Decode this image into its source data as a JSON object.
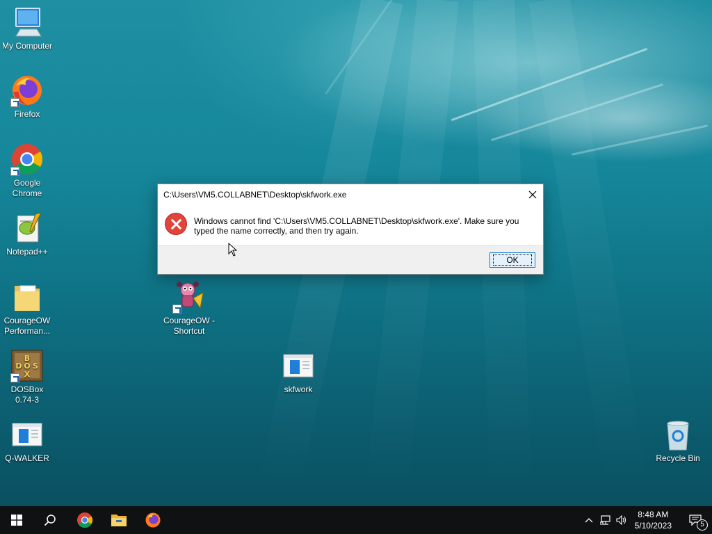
{
  "desktop": {
    "icons": [
      {
        "label": "My Computer",
        "icon": "computer-icon"
      },
      {
        "label": "Firefox",
        "icon": "firefox-icon"
      },
      {
        "label": "Google Chrome",
        "icon": "chrome-icon"
      },
      {
        "label": "Notepad++",
        "icon": "notepadpp-icon"
      },
      {
        "label": "CourageOW Performan...",
        "icon": "folder-icon"
      },
      {
        "label": "DOSBox 0.74-3",
        "icon": "dosbox-icon"
      },
      {
        "label": "Q-WALKER",
        "icon": "app-window-icon"
      },
      {
        "label": "CourageOW - Shortcut",
        "icon": "courage-icon"
      },
      {
        "label": "skfwork",
        "icon": "app-window-icon"
      },
      {
        "label": "Recycle Bin",
        "icon": "recycle-bin-icon"
      }
    ]
  },
  "dialog": {
    "title": "C:\\Users\\VM5.COLLABNET\\Desktop\\skfwork.exe",
    "message": "Windows cannot find 'C:\\Users\\VM5.COLLABNET\\Desktop\\skfwork.exe'. Make sure you typed the name correctly, and then try again.",
    "ok_label": "OK",
    "icon": "error-icon"
  },
  "taskbar": {
    "pinned": [
      "start-icon",
      "search-icon",
      "chrome-icon",
      "file-explorer-icon",
      "firefox-icon"
    ],
    "clock": {
      "time": "8:48 AM",
      "date": "5/10/2023"
    },
    "notification_count": "5"
  },
  "colors": {
    "error_red": "#e0443b",
    "ok_border": "#0078d7",
    "taskbar_bg": "#101112"
  }
}
